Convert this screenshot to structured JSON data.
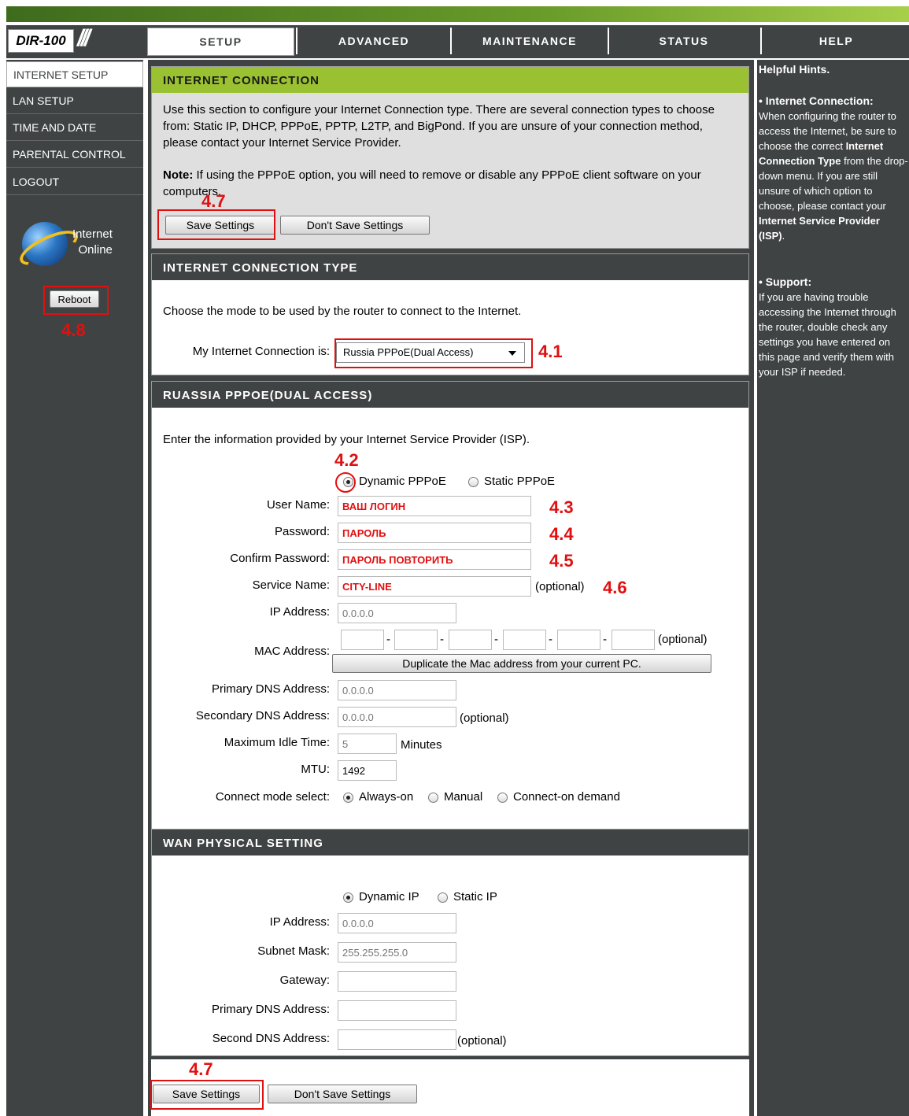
{
  "header": {
    "logo": "DIR-100",
    "tabs": [
      {
        "label": "SETUP"
      },
      {
        "label": "ADVANCED"
      },
      {
        "label": "MAINTENANCE"
      },
      {
        "label": "STATUS"
      },
      {
        "label": "HELP"
      }
    ]
  },
  "sidebar": {
    "items": [
      {
        "label": "INTERNET SETUP"
      },
      {
        "label": "LAN SETUP"
      },
      {
        "label": "TIME AND DATE"
      },
      {
        "label": "PARENTAL CONTROL"
      },
      {
        "label": "LOGOUT"
      }
    ],
    "status_line1": "Internet",
    "status_line2": "Online",
    "reboot_label": "Reboot"
  },
  "annotations": {
    "a41": "4.1",
    "a42": "4.2",
    "a43": "4.3",
    "a44": "4.4",
    "a45": "4.5",
    "a46": "4.6",
    "a47": "4.7",
    "a48": "4.8"
  },
  "internet_connection": {
    "title": "INTERNET CONNECTION",
    "description": "Use this section to configure your Internet Connection type. There are several connection types to choose from: Static IP, DHCP, PPPoE, PPTP, L2TP, and BigPond. If you are unsure of your connection method, please contact your Internet Service Provider.",
    "note_label": "Note:",
    "note_text": " If using the PPPoE option, you will need to remove or disable any PPPoE client software on your computers.",
    "save_label": "Save Settings",
    "dont_save_label": "Don't Save Settings"
  },
  "connection_type": {
    "title": "INTERNET CONNECTION TYPE",
    "description": "Choose the mode to be used by the router to connect to the Internet.",
    "label": "My Internet Connection is:",
    "selected": "Russia PPPoE(Dual Access)"
  },
  "pppoe": {
    "title": "RUASSIA PPPOE(DUAL ACCESS)",
    "description": "Enter the information provided by your Internet Service Provider (ISP).",
    "mode_dynamic": "Dynamic PPPoE",
    "mode_static": "Static PPPoE",
    "user_name_label": "User Name:",
    "user_name_value": "ВАШ ЛОГИН",
    "password_label": "Password:",
    "password_value": "ПАРОЛЬ",
    "confirm_label": "Confirm Password:",
    "confirm_value": "ПАРОЛЬ ПОВТОРИТЬ",
    "service_label": "Service Name:",
    "service_value": "CITY-LINE",
    "optional": "(optional)",
    "ip_label": "IP Address:",
    "ip_value": "0.0.0.0",
    "mac_label": "MAC Address:",
    "mac_sep": "-",
    "duplicate_label": "Duplicate the Mac address from your current PC.",
    "primary_dns_label": "Primary DNS Address:",
    "primary_dns_value": "0.0.0.0",
    "secondary_dns_label": "Secondary DNS Address:",
    "secondary_dns_value": "0.0.0.0",
    "idle_label": "Maximum Idle Time:",
    "idle_value": "5",
    "idle_unit": "Minutes",
    "mtu_label": "MTU:",
    "mtu_value": "1492",
    "connect_mode_label": "Connect mode select:",
    "mode_always": "Always-on",
    "mode_manual": "Manual",
    "mode_demand": "Connect-on demand"
  },
  "wan": {
    "title": "WAN PHYSICAL SETTING",
    "dynamic_ip": "Dynamic IP",
    "static_ip": "Static IP",
    "ip_label": "IP Address:",
    "ip_value": "0.0.0.0",
    "subnet_label": "Subnet Mask:",
    "subnet_value": "255.255.255.0",
    "gateway_label": "Gateway:",
    "primary_dns_label": "Primary DNS Address:",
    "second_dns_label": "Second DNS Address:",
    "optional": "(optional)"
  },
  "bottom": {
    "save_label": "Save Settings",
    "dont_save_label": "Don't Save Settings"
  },
  "help": {
    "title": "Helpful Hints.",
    "ic_heading": "• Internet Connection:",
    "ic_text1": "When configuring the router to access the Internet, be sure to choose the correct ",
    "ic_bold": "Internet Connection Type",
    "ic_text2": " from the drop-down menu. If you are still unsure of which option to choose, please contact your ",
    "ic_bold2": "Internet Service Provider (ISP)",
    "ic_text3": ".",
    "support_heading": "• Support:",
    "support_text": "If you are having trouble accessing the Internet through the router, double check any settings you have entered on this page and verify them with your ISP if needed."
  }
}
